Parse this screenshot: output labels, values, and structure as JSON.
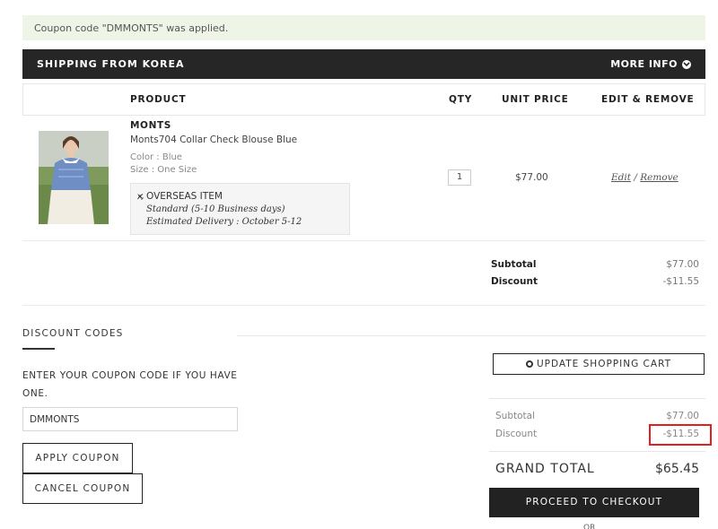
{
  "notice": {
    "text": "Coupon code \"DMMONTS\" was applied."
  },
  "shipping_bar": {
    "title": "SHIPPING FROM KOREA",
    "more_info": "MORE INFO"
  },
  "table": {
    "headers": {
      "product": "PRODUCT",
      "qty": "QTY",
      "unit_price": "UNIT PRICE",
      "edit_remove": "EDIT & REMOVE"
    }
  },
  "item": {
    "brand": "MONTS",
    "name": "Monts704 Collar Check Blouse Blue",
    "color": "Color : Blue",
    "size": "Size : One Size",
    "overseas_title": "OVERSEAS ITEM",
    "shipping_method": "Standard (5-10 Business days)",
    "estimated_delivery": "Estimated Delivery : October 5-12",
    "qty": "1",
    "unit_price": "$77.00",
    "edit_label": "Edit",
    "separator": "/",
    "remove_label": "Remove"
  },
  "item_summary": {
    "subtotal_label": "Subtotal",
    "subtotal_value": "$77.00",
    "discount_label": "Discount",
    "discount_value": "-$11.55"
  },
  "discount_codes": {
    "heading": "DISCOUNT CODES",
    "instructions": "ENTER YOUR COUPON CODE IF YOU HAVE ONE.",
    "coupon_value": "DMMONTS",
    "apply_label": "APPLY COUPON",
    "cancel_label": "CANCEL COUPON"
  },
  "cart": {
    "update_label": "UPDATE SHOPPING CART",
    "subtotal_label": "Subtotal",
    "subtotal_value": "$77.00",
    "discount_label": "Discount",
    "discount_value": "-$11.55",
    "grand_total_label": "GRAND TOTAL",
    "grand_total_value": "$65.45",
    "checkout_label": "PROCEED TO CHECKOUT",
    "or_text": "OR"
  },
  "colors": {
    "highlight_box": "#e02020",
    "bar_dark": "#262626",
    "notice_bg": "#eef5e6"
  }
}
